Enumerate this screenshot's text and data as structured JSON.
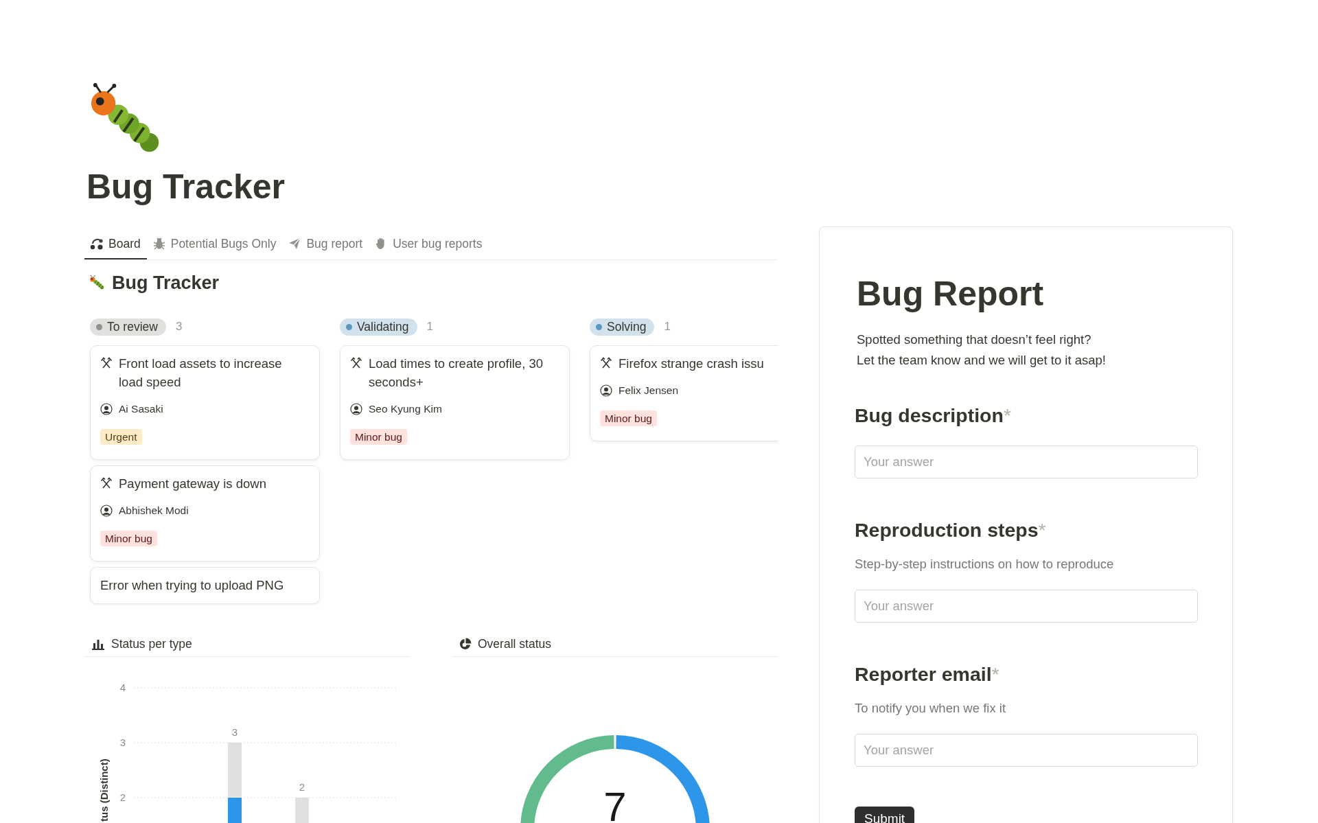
{
  "page": {
    "title": "Bug Tracker"
  },
  "tabs": [
    {
      "label": "Board",
      "selected": true,
      "kind": "board"
    },
    {
      "label": "Potential Bugs Only",
      "selected": false,
      "kind": "bug"
    },
    {
      "label": "Bug report",
      "selected": false,
      "kind": "send"
    },
    {
      "label": "User bug reports",
      "selected": false,
      "kind": "hand"
    }
  ],
  "board": {
    "title": "Bug Tracker",
    "groups": [
      {
        "name": "To review",
        "color": "#91918e",
        "count": "3",
        "cards": [
          {
            "title": "Front load assets to increase load speed",
            "icon": true,
            "assignee": "Ai Sasaki",
            "tag": {
              "label": "Urgent",
              "kind": "urgent"
            }
          },
          {
            "title": "Payment gateway is down",
            "icon": true,
            "assignee": "Abhishek Modi",
            "tag": {
              "label": "Minor bug",
              "kind": "minor"
            }
          },
          {
            "title": "Error when trying to upload PNG",
            "icon": false
          }
        ]
      },
      {
        "name": "Validating",
        "color": "#5b97bd",
        "count": "1",
        "cards": [
          {
            "title": "Load times to create profile, 30 seconds+",
            "icon": true,
            "assignee": "Seo Kyung Kim",
            "tag": {
              "label": "Minor bug",
              "kind": "minor"
            }
          }
        ]
      },
      {
        "name": "Solving",
        "color": "#5b97bd",
        "count": "1",
        "cards": [
          {
            "title": "Firefox strange crash issu",
            "icon": true,
            "assignee": "Felix Jensen",
            "tag": {
              "label": "Minor bug",
              "kind": "minor"
            }
          }
        ]
      }
    ]
  },
  "charts": [
    {
      "title": "Status per type",
      "kind": "bar",
      "chart_data": {
        "type": "bar",
        "ylabel": "tus (Distinct)",
        "ylim": [
          0,
          4
        ],
        "yticks": [
          2,
          3,
          4
        ],
        "stacked": true,
        "series": [
          {
            "color": "#2e96e8",
            "values": [
              2,
              null
            ]
          },
          {
            "color": "#e1e0de",
            "values": [
              1,
              2
            ]
          }
        ],
        "annotations": [
          {
            "y": 3,
            "text": "3"
          },
          {
            "y": 2,
            "text": "2"
          }
        ]
      }
    },
    {
      "title": "Overall status",
      "kind": "donut",
      "total": "7"
    }
  ],
  "form": {
    "title": "Bug Report",
    "description": [
      "Spotted something that doesn’t feel right?",
      "Let the team know and we will get to it asap!"
    ],
    "questions": [
      {
        "label": "Bug description",
        "marker": "*",
        "placeholder": "Your answer"
      },
      {
        "label": "Reproduction steps",
        "marker": "*",
        "hint": "Step-by-step instructions on how to reproduce",
        "placeholder": "Your answer"
      },
      {
        "label": "Reporter email",
        "marker": "*",
        "hint": "To notify you when we fix it",
        "placeholder": "Your answer"
      }
    ],
    "submit": "Submit"
  }
}
